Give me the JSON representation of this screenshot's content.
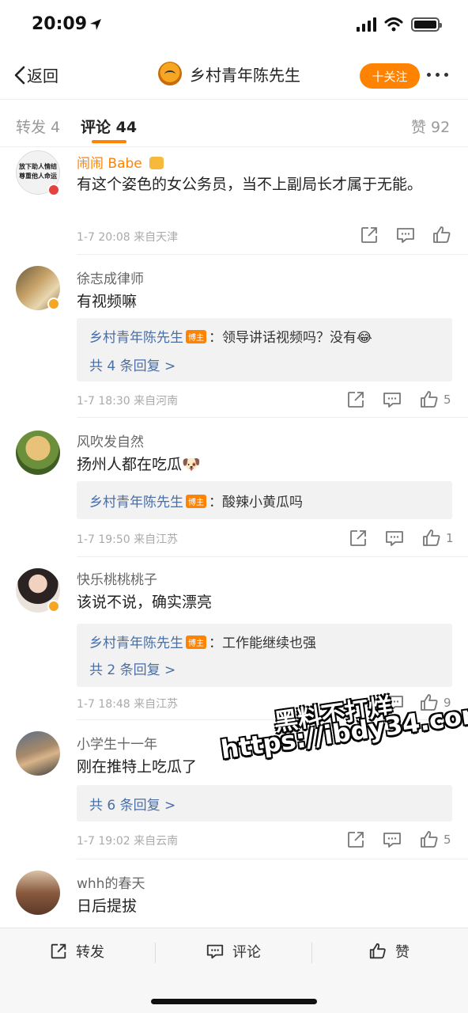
{
  "status_bar": {
    "time": "20:09"
  },
  "nav": {
    "back_label": "返回",
    "title": "乡村青年陈先生",
    "follow_label": "十关注"
  },
  "tabs": {
    "repost": "转发 4",
    "comments": "评论 44",
    "likes": "赞 92"
  },
  "comments": [
    {
      "user": "闹闹 Babe",
      "avatar_text": "放下助人情结 尊重他人命运",
      "text": "有这个姿色的女公务员，当不上副局长才属于无能。",
      "meta": "1-7 20:08  来自天津",
      "likes": ""
    },
    {
      "user": "徐志成律师",
      "text": "有视频嘛",
      "reply_user": "乡村青年陈先生",
      "reply_text": "：领导讲话视频吗？没有😂",
      "reply_more": "共 4 条回复 >",
      "meta": "1-7 18:30  来自河南",
      "likes": "5"
    },
    {
      "user": "风吹发自然",
      "text": "扬州人都在吃瓜🐶",
      "reply_user": "乡村青年陈先生",
      "reply_text": "：酸辣小黄瓜吗",
      "meta": "1-7 19:50  来自江苏",
      "likes": "1"
    },
    {
      "user": "快乐桃桃桃子",
      "text": "该说不说，确实漂亮",
      "reply_user": "乡村青年陈先生",
      "reply_text": "：工作能继续也强",
      "reply_more": "共 2 条回复 >",
      "meta": "1-7 18:48  来自江苏",
      "likes": "9"
    },
    {
      "user": "小学生十一年",
      "text": "刚在推特上吃瓜了",
      "reply_more": "共 6 条回复 >",
      "meta": "1-7 19:02  来自云南",
      "likes": "5"
    },
    {
      "user": "whh的春天",
      "text": "日后提拔"
    }
  ],
  "reply_badge": "博主",
  "bottom_bar": {
    "repost": "转发",
    "comment": "评论",
    "like": "赞"
  },
  "watermark": {
    "line1": "黑料不打烊",
    "line2": "https://ibdy34.com"
  },
  "colors": {
    "accent": "#ff8200",
    "link": "#4a6fa5"
  }
}
